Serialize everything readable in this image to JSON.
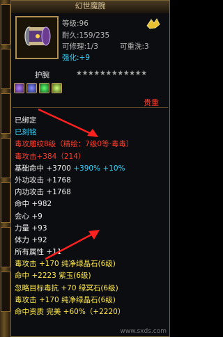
{
  "item": {
    "title": "幻世魔腕",
    "level_label": "等级:96",
    "durability_label": "耐久:159/235",
    "reforge_label": "可修理:",
    "reforge_value": "1/3",
    "rewash_label": "可重洗:",
    "rewash_value": "3",
    "enhance_label": "强化:",
    "enhance_value": "+9",
    "type": "护腕",
    "stars": "★★★★★★★★★★★★",
    "value_label": "贵重"
  },
  "attributes": [
    {
      "text": "已绑定",
      "color": "white"
    },
    {
      "text": "已刻铭",
      "color": "cyan"
    },
    {
      "text": "毒攻雕纹8级（精绘：7级0等·毒毒）",
      "color": "red"
    },
    {
      "text": "毒攻击+384（214）",
      "color": "red"
    },
    {
      "text": "基础命中 +3700 +390% +10%",
      "color": "mixed"
    },
    {
      "text": "外功攻击 +1768",
      "color": "white"
    },
    {
      "text": "内功攻击 +1768",
      "color": "white"
    },
    {
      "text": "命中 +982",
      "color": "white"
    },
    {
      "text": "会心 +9",
      "color": "white"
    },
    {
      "text": "力量 +93",
      "color": "white"
    },
    {
      "text": "体力 +92",
      "color": "white"
    },
    {
      "text": "所有属性 +11",
      "color": "white"
    },
    {
      "text": "毒攻击 +170 纯净绿晶石(6级)",
      "color": "yellow"
    },
    {
      "text": "命中 +2223 紫玉(6级)",
      "color": "yellow"
    },
    {
      "text": "忽略目标毒抗 +70 绿冥石(6级)",
      "color": "yellow"
    },
    {
      "text": "毒攻击 +170 纯净绿晶石(6级)",
      "color": "yellow"
    },
    {
      "text": "命中资质 完美 +60%（+2220）",
      "color": "yellow"
    }
  ],
  "hit_base": {
    "label": "基础命中",
    "v1": "+3700",
    "v2": "+390%",
    "v3": "+10%"
  },
  "watermark": "www.sxds.com",
  "colors": {
    "cyan": "#33d6ff",
    "yellow": "#ffe94a",
    "red": "#ff3b2a",
    "frame": "#7a6436"
  }
}
